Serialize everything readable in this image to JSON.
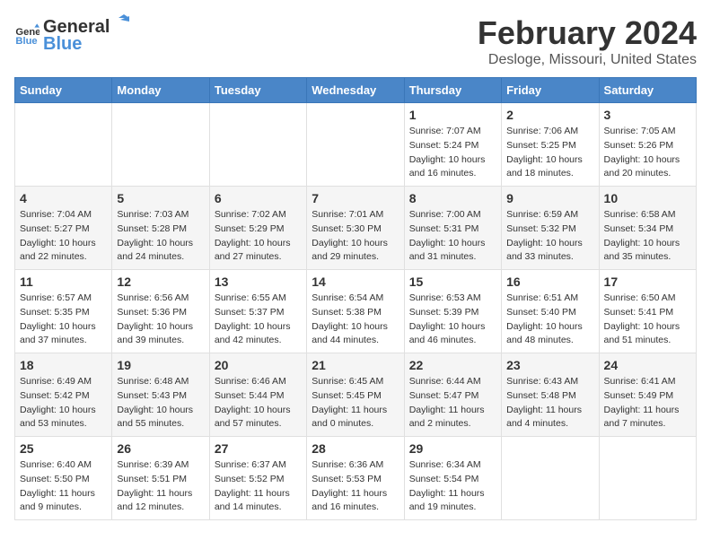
{
  "logo": {
    "general": "General",
    "blue": "Blue"
  },
  "header": {
    "title": "February 2024",
    "subtitle": "Desloge, Missouri, United States"
  },
  "weekdays": [
    "Sunday",
    "Monday",
    "Tuesday",
    "Wednesday",
    "Thursday",
    "Friday",
    "Saturday"
  ],
  "weeks": [
    [
      {
        "day": "",
        "sunrise": "",
        "sunset": "",
        "daylight": ""
      },
      {
        "day": "",
        "sunrise": "",
        "sunset": "",
        "daylight": ""
      },
      {
        "day": "",
        "sunrise": "",
        "sunset": "",
        "daylight": ""
      },
      {
        "day": "",
        "sunrise": "",
        "sunset": "",
        "daylight": ""
      },
      {
        "day": "1",
        "sunrise": "7:07 AM",
        "sunset": "5:24 PM",
        "daylight": "10 hours and 16 minutes."
      },
      {
        "day": "2",
        "sunrise": "7:06 AM",
        "sunset": "5:25 PM",
        "daylight": "10 hours and 18 minutes."
      },
      {
        "day": "3",
        "sunrise": "7:05 AM",
        "sunset": "5:26 PM",
        "daylight": "10 hours and 20 minutes."
      }
    ],
    [
      {
        "day": "4",
        "sunrise": "7:04 AM",
        "sunset": "5:27 PM",
        "daylight": "10 hours and 22 minutes."
      },
      {
        "day": "5",
        "sunrise": "7:03 AM",
        "sunset": "5:28 PM",
        "daylight": "10 hours and 24 minutes."
      },
      {
        "day": "6",
        "sunrise": "7:02 AM",
        "sunset": "5:29 PM",
        "daylight": "10 hours and 27 minutes."
      },
      {
        "day": "7",
        "sunrise": "7:01 AM",
        "sunset": "5:30 PM",
        "daylight": "10 hours and 29 minutes."
      },
      {
        "day": "8",
        "sunrise": "7:00 AM",
        "sunset": "5:31 PM",
        "daylight": "10 hours and 31 minutes."
      },
      {
        "day": "9",
        "sunrise": "6:59 AM",
        "sunset": "5:32 PM",
        "daylight": "10 hours and 33 minutes."
      },
      {
        "day": "10",
        "sunrise": "6:58 AM",
        "sunset": "5:34 PM",
        "daylight": "10 hours and 35 minutes."
      }
    ],
    [
      {
        "day": "11",
        "sunrise": "6:57 AM",
        "sunset": "5:35 PM",
        "daylight": "10 hours and 37 minutes."
      },
      {
        "day": "12",
        "sunrise": "6:56 AM",
        "sunset": "5:36 PM",
        "daylight": "10 hours and 39 minutes."
      },
      {
        "day": "13",
        "sunrise": "6:55 AM",
        "sunset": "5:37 PM",
        "daylight": "10 hours and 42 minutes."
      },
      {
        "day": "14",
        "sunrise": "6:54 AM",
        "sunset": "5:38 PM",
        "daylight": "10 hours and 44 minutes."
      },
      {
        "day": "15",
        "sunrise": "6:53 AM",
        "sunset": "5:39 PM",
        "daylight": "10 hours and 46 minutes."
      },
      {
        "day": "16",
        "sunrise": "6:51 AM",
        "sunset": "5:40 PM",
        "daylight": "10 hours and 48 minutes."
      },
      {
        "day": "17",
        "sunrise": "6:50 AM",
        "sunset": "5:41 PM",
        "daylight": "10 hours and 51 minutes."
      }
    ],
    [
      {
        "day": "18",
        "sunrise": "6:49 AM",
        "sunset": "5:42 PM",
        "daylight": "10 hours and 53 minutes."
      },
      {
        "day": "19",
        "sunrise": "6:48 AM",
        "sunset": "5:43 PM",
        "daylight": "10 hours and 55 minutes."
      },
      {
        "day": "20",
        "sunrise": "6:46 AM",
        "sunset": "5:44 PM",
        "daylight": "10 hours and 57 minutes."
      },
      {
        "day": "21",
        "sunrise": "6:45 AM",
        "sunset": "5:45 PM",
        "daylight": "11 hours and 0 minutes."
      },
      {
        "day": "22",
        "sunrise": "6:44 AM",
        "sunset": "5:47 PM",
        "daylight": "11 hours and 2 minutes."
      },
      {
        "day": "23",
        "sunrise": "6:43 AM",
        "sunset": "5:48 PM",
        "daylight": "11 hours and 4 minutes."
      },
      {
        "day": "24",
        "sunrise": "6:41 AM",
        "sunset": "5:49 PM",
        "daylight": "11 hours and 7 minutes."
      }
    ],
    [
      {
        "day": "25",
        "sunrise": "6:40 AM",
        "sunset": "5:50 PM",
        "daylight": "11 hours and 9 minutes."
      },
      {
        "day": "26",
        "sunrise": "6:39 AM",
        "sunset": "5:51 PM",
        "daylight": "11 hours and 12 minutes."
      },
      {
        "day": "27",
        "sunrise": "6:37 AM",
        "sunset": "5:52 PM",
        "daylight": "11 hours and 14 minutes."
      },
      {
        "day": "28",
        "sunrise": "6:36 AM",
        "sunset": "5:53 PM",
        "daylight": "11 hours and 16 minutes."
      },
      {
        "day": "29",
        "sunrise": "6:34 AM",
        "sunset": "5:54 PM",
        "daylight": "11 hours and 19 minutes."
      },
      {
        "day": "",
        "sunrise": "",
        "sunset": "",
        "daylight": ""
      },
      {
        "day": "",
        "sunrise": "",
        "sunset": "",
        "daylight": ""
      }
    ]
  ],
  "labels": {
    "sunrise": "Sunrise:",
    "sunset": "Sunset:",
    "daylight": "Daylight:"
  }
}
